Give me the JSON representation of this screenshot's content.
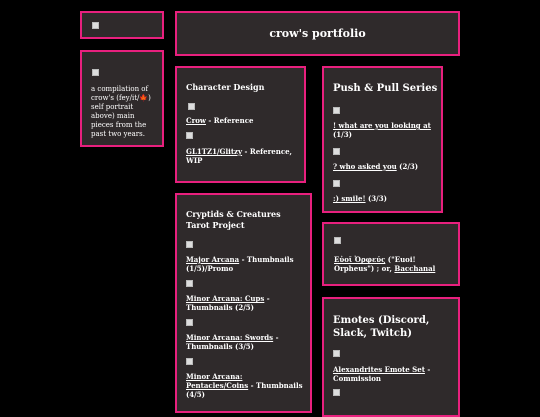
{
  "header": {
    "title": "crow's portfolio"
  },
  "sidebar": {
    "description": "a compilation of crow's (fey/it/🍁) self portrait above) main pieces from the past two years."
  },
  "character_design": {
    "title": "Character Design",
    "items": [
      {
        "link": "Crow",
        "suffix": " - Reference"
      },
      {
        "link": "GL1TZ1/Glitzy",
        "suffix": " - Reference, WIP"
      }
    ]
  },
  "push_pull": {
    "title": "Push & Pull Series",
    "items": [
      {
        "link": "! what are you looking at",
        "suffix": " (1/3)"
      },
      {
        "link": "? who asked you",
        "suffix": " (2/3)"
      },
      {
        "link": ":) smile!",
        "suffix": " (3/3)"
      }
    ]
  },
  "tarot": {
    "title": "Cryptids & Creatures Tarot Project",
    "items": [
      {
        "link": "Major Arcana",
        "suffix": " - Thumbnails (1/5)/Promo"
      },
      {
        "link": "Minor Arcana: Cups",
        "suffix": " - Thumbnails (2/5)"
      },
      {
        "link": "Minor Arcana: Swords",
        "suffix": " - Thumbnails (3/5)"
      },
      {
        "link": "Minor Arcana: Pentacles/Coins",
        "suffix": " - Thumbnails (4/5)"
      }
    ]
  },
  "euoi": {
    "link": "Εὐοῖ Ὀρφεύς",
    "middle": " (\"Euoi! Orpheus\") ; or, ",
    "link2": "Bacchanal"
  },
  "emotes": {
    "title": "Emotes (Discord, Slack, Twitch)",
    "items": [
      {
        "link": "Alexandrites Emote Set",
        "suffix": " - Commission"
      }
    ]
  },
  "colors": {
    "background": "#000000",
    "panel": "#2f2a2b",
    "border": "#e8207e",
    "text": "#ffffff"
  },
  "icons": [
    "broken-image-icon"
  ]
}
